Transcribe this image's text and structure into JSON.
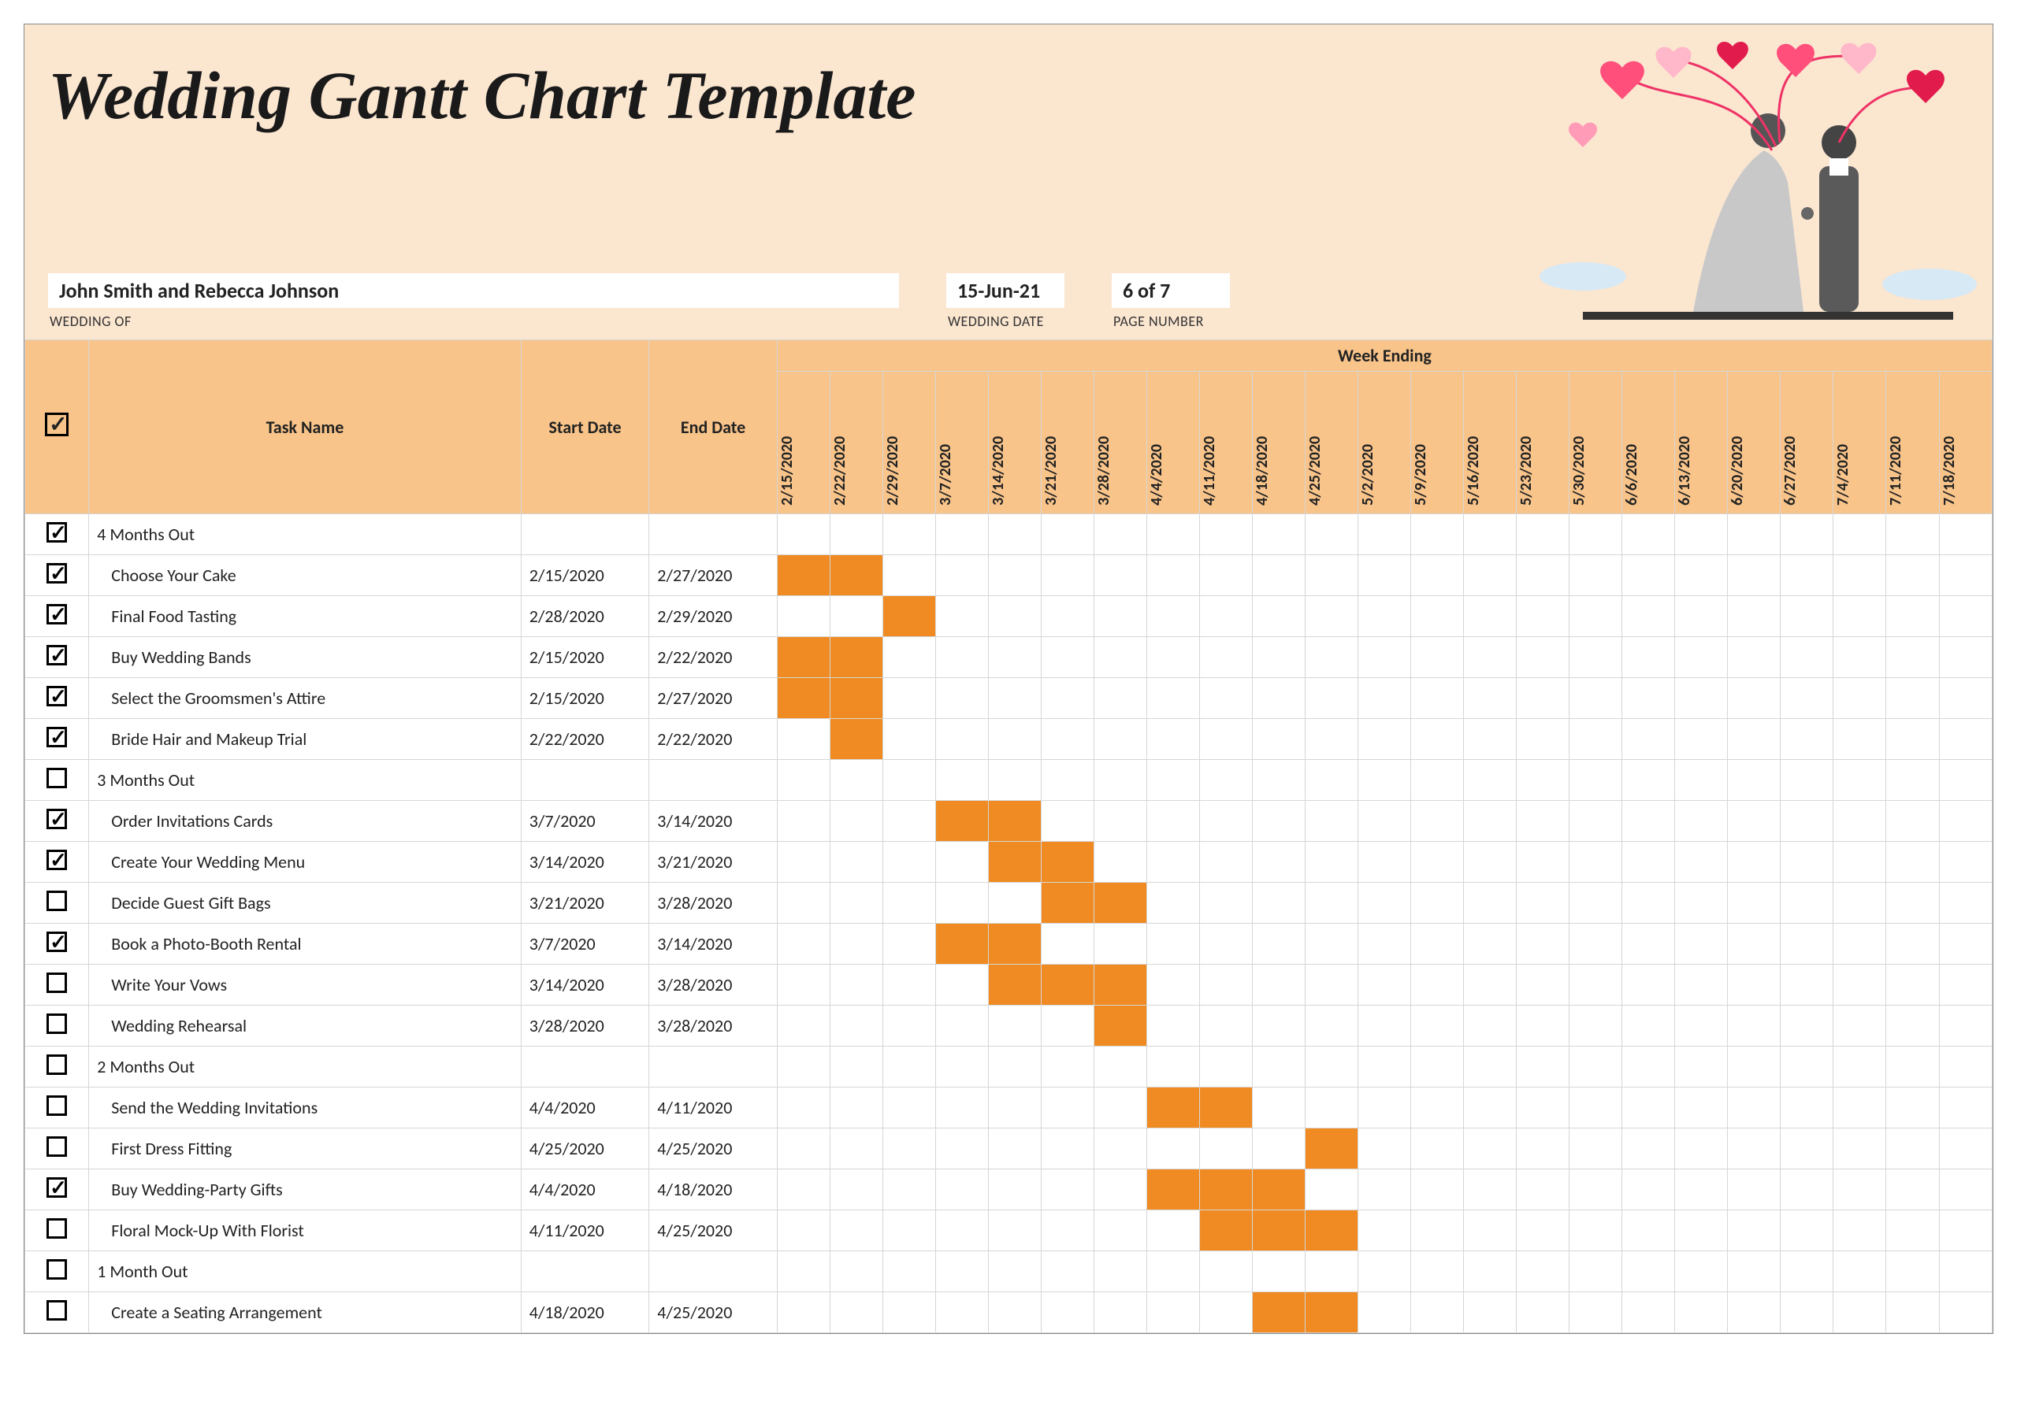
{
  "title": "Wedding Gantt Chart Template",
  "info": {
    "couple": {
      "value": "John Smith and Rebecca Johnson",
      "label": "WEDDING OF"
    },
    "date": {
      "value": "15-Jun-21",
      "label": "WEDDING DATE"
    },
    "page": {
      "value": "6 of 7",
      "label": "PAGE NUMBER"
    }
  },
  "headers": {
    "task": "Task Name",
    "start": "Start Date",
    "end": "End Date",
    "week_ending": "Week Ending"
  },
  "weeks": [
    "2/15/2020",
    "2/22/2020",
    "2/29/2020",
    "3/7/2020",
    "3/14/2020",
    "3/21/2020",
    "3/28/2020",
    "4/4/2020",
    "4/11/2020",
    "4/18/2020",
    "4/25/2020",
    "5/2/2020",
    "5/9/2020",
    "5/16/2020",
    "5/23/2020",
    "5/30/2020",
    "6/6/2020",
    "6/13/2020",
    "6/20/2020",
    "6/27/2020",
    "7/4/2020",
    "7/11/2020",
    "7/18/2020"
  ],
  "rows": [
    {
      "checked": true,
      "indent": 0,
      "name": "4 Months Out",
      "start": "",
      "end": "",
      "bar": []
    },
    {
      "checked": true,
      "indent": 1,
      "name": "Choose Your Cake",
      "start": "2/15/2020",
      "end": "2/27/2020",
      "bar": [
        0,
        1
      ]
    },
    {
      "checked": true,
      "indent": 1,
      "name": "Final Food Tasting",
      "start": "2/28/2020",
      "end": "2/29/2020",
      "bar": [
        2
      ]
    },
    {
      "checked": true,
      "indent": 1,
      "name": "Buy Wedding Bands",
      "start": "2/15/2020",
      "end": "2/22/2020",
      "bar": [
        0,
        1
      ]
    },
    {
      "checked": true,
      "indent": 1,
      "name": "Select the Groomsmen's Attire",
      "start": "2/15/2020",
      "end": "2/27/2020",
      "bar": [
        0,
        1
      ]
    },
    {
      "checked": true,
      "indent": 1,
      "name": "Bride Hair and Makeup Trial",
      "start": "2/22/2020",
      "end": "2/22/2020",
      "bar": [
        1
      ]
    },
    {
      "checked": false,
      "indent": 0,
      "name": "3 Months Out",
      "start": "",
      "end": "",
      "bar": []
    },
    {
      "checked": true,
      "indent": 1,
      "name": "Order Invitations Cards",
      "start": "3/7/2020",
      "end": "3/14/2020",
      "bar": [
        3,
        4
      ]
    },
    {
      "checked": true,
      "indent": 1,
      "name": "Create Your Wedding Menu",
      "start": "3/14/2020",
      "end": "3/21/2020",
      "bar": [
        4,
        5
      ]
    },
    {
      "checked": false,
      "indent": 1,
      "name": "Decide Guest Gift Bags",
      "start": "3/21/2020",
      "end": "3/28/2020",
      "bar": [
        5,
        6
      ]
    },
    {
      "checked": true,
      "indent": 1,
      "name": "Book a Photo-Booth Rental",
      "start": "3/7/2020",
      "end": "3/14/2020",
      "bar": [
        3,
        4
      ]
    },
    {
      "checked": false,
      "indent": 1,
      "name": "Write Your Vows",
      "start": "3/14/2020",
      "end": "3/28/2020",
      "bar": [
        4,
        5,
        6
      ]
    },
    {
      "checked": false,
      "indent": 1,
      "name": "Wedding Rehearsal",
      "start": "3/28/2020",
      "end": "3/28/2020",
      "bar": [
        6
      ]
    },
    {
      "checked": false,
      "indent": 0,
      "name": "2 Months Out",
      "start": "",
      "end": "",
      "bar": []
    },
    {
      "checked": false,
      "indent": 1,
      "name": "Send the Wedding Invitations",
      "start": "4/4/2020",
      "end": "4/11/2020",
      "bar": [
        7,
        8
      ]
    },
    {
      "checked": false,
      "indent": 1,
      "name": "First Dress Fitting",
      "start": "4/25/2020",
      "end": "4/25/2020",
      "bar": [
        10
      ]
    },
    {
      "checked": true,
      "indent": 1,
      "name": "Buy Wedding-Party Gifts",
      "start": "4/4/2020",
      "end": "4/18/2020",
      "bar": [
        7,
        8,
        9
      ]
    },
    {
      "checked": false,
      "indent": 1,
      "name": "Floral Mock-Up With Florist",
      "start": "4/11/2020",
      "end": "4/25/2020",
      "bar": [
        8,
        9,
        10
      ]
    },
    {
      "checked": false,
      "indent": 0,
      "name": "1 Month Out",
      "start": "",
      "end": "",
      "bar": []
    },
    {
      "checked": false,
      "indent": 1,
      "name": "Create a Seating Arrangement",
      "start": "4/18/2020",
      "end": "4/25/2020",
      "bar": [
        9,
        10
      ]
    }
  ],
  "chart_data": {
    "type": "bar",
    "title": "Wedding Gantt Chart Template",
    "xlabel": "Week Ending",
    "ylabel": "Task Name",
    "categories": [
      "2/15/2020",
      "2/22/2020",
      "2/29/2020",
      "3/7/2020",
      "3/14/2020",
      "3/21/2020",
      "3/28/2020",
      "4/4/2020",
      "4/11/2020",
      "4/18/2020",
      "4/25/2020",
      "5/2/2020",
      "5/9/2020",
      "5/16/2020",
      "5/23/2020",
      "5/30/2020",
      "6/6/2020",
      "6/13/2020",
      "6/20/2020",
      "6/27/2020",
      "7/4/2020",
      "7/11/2020",
      "7/18/2020"
    ],
    "series": [
      {
        "name": "Choose Your Cake",
        "start": "2/15/2020",
        "end": "2/27/2020"
      },
      {
        "name": "Final Food Tasting",
        "start": "2/28/2020",
        "end": "2/29/2020"
      },
      {
        "name": "Buy Wedding Bands",
        "start": "2/15/2020",
        "end": "2/22/2020"
      },
      {
        "name": "Select the Groomsmen's Attire",
        "start": "2/15/2020",
        "end": "2/27/2020"
      },
      {
        "name": "Bride Hair and Makeup Trial",
        "start": "2/22/2020",
        "end": "2/22/2020"
      },
      {
        "name": "Order Invitations Cards",
        "start": "3/7/2020",
        "end": "3/14/2020"
      },
      {
        "name": "Create Your Wedding Menu",
        "start": "3/14/2020",
        "end": "3/21/2020"
      },
      {
        "name": "Decide Guest Gift Bags",
        "start": "3/21/2020",
        "end": "3/28/2020"
      },
      {
        "name": "Book a Photo-Booth Rental",
        "start": "3/7/2020",
        "end": "3/14/2020"
      },
      {
        "name": "Write Your Vows",
        "start": "3/14/2020",
        "end": "3/28/2020"
      },
      {
        "name": "Wedding Rehearsal",
        "start": "3/28/2020",
        "end": "3/28/2020"
      },
      {
        "name": "Send the Wedding Invitations",
        "start": "4/4/2020",
        "end": "4/11/2020"
      },
      {
        "name": "First Dress Fitting",
        "start": "4/25/2020",
        "end": "4/25/2020"
      },
      {
        "name": "Buy Wedding-Party Gifts",
        "start": "4/4/2020",
        "end": "4/18/2020"
      },
      {
        "name": "Floral Mock-Up With Florist",
        "start": "4/11/2020",
        "end": "4/25/2020"
      },
      {
        "name": "Create a Seating Arrangement",
        "start": "4/18/2020",
        "end": "4/25/2020"
      }
    ]
  }
}
